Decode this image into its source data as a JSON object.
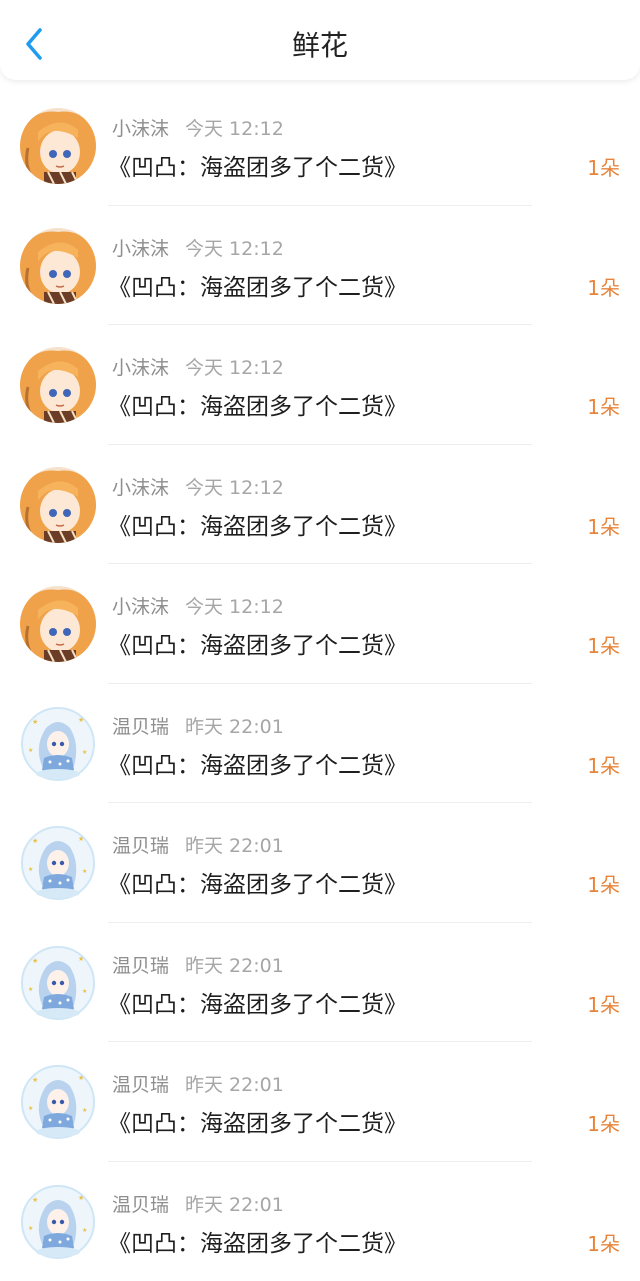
{
  "header": {
    "title": "鲜花"
  },
  "theme": {
    "accent": "#1e9bf0",
    "count_color": "#e8843a"
  },
  "items": [
    {
      "user": "小沫沫",
      "time": "今天 12:12",
      "book": "《凹凸：海盗团多了个二货》",
      "count": "1朵",
      "avatar": "orange-haired-avatar"
    },
    {
      "user": "小沫沫",
      "time": "今天 12:12",
      "book": "《凹凸：海盗团多了个二货》",
      "count": "1朵",
      "avatar": "orange-haired-avatar"
    },
    {
      "user": "小沫沫",
      "time": "今天 12:12",
      "book": "《凹凸：海盗团多了个二货》",
      "count": "1朵",
      "avatar": "orange-haired-avatar"
    },
    {
      "user": "小沫沫",
      "time": "今天 12:12",
      "book": "《凹凸：海盗团多了个二货》",
      "count": "1朵",
      "avatar": "orange-haired-avatar"
    },
    {
      "user": "小沫沫",
      "time": "今天 12:12",
      "book": "《凹凸：海盗团多了个二货》",
      "count": "1朵",
      "avatar": "orange-haired-avatar"
    },
    {
      "user": "温贝瑞",
      "time": "昨天 22:01",
      "book": "《凹凸：海盗团多了个二货》",
      "count": "1朵",
      "avatar": "blue-haired-avatar"
    },
    {
      "user": "温贝瑞",
      "time": "昨天 22:01",
      "book": "《凹凸：海盗团多了个二货》",
      "count": "1朵",
      "avatar": "blue-haired-avatar"
    },
    {
      "user": "温贝瑞",
      "time": "昨天 22:01",
      "book": "《凹凸：海盗团多了个二货》",
      "count": "1朵",
      "avatar": "blue-haired-avatar"
    },
    {
      "user": "温贝瑞",
      "time": "昨天 22:01",
      "book": "《凹凸：海盗团多了个二货》",
      "count": "1朵",
      "avatar": "blue-haired-avatar"
    },
    {
      "user": "温贝瑞",
      "time": "昨天 22:01",
      "book": "《凹凸：海盗团多了个二货》",
      "count": "1朵",
      "avatar": "blue-haired-avatar"
    }
  ]
}
